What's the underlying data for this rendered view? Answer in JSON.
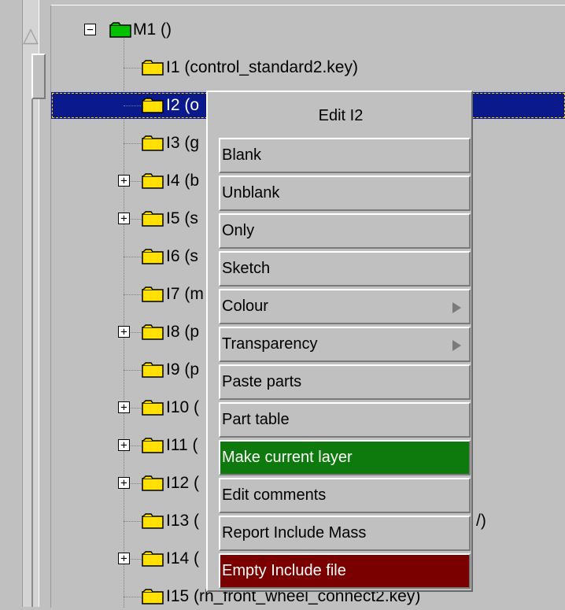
{
  "tree": {
    "root": {
      "label": "M1 ()",
      "expander": "⊟",
      "icon": "folder-green-icon"
    },
    "items": [
      {
        "label": "I1 (control_standard2.key)",
        "expander": ""
      },
      {
        "label": "I2 (o",
        "expander": "",
        "selected": true
      },
      {
        "label": "I3 (g",
        "expander": ""
      },
      {
        "label": "I4 (b",
        "expander": "+"
      },
      {
        "label": "I5 (s",
        "expander": "+"
      },
      {
        "label": "I6 (s",
        "expander": ""
      },
      {
        "label": "I7 (m",
        "expander": ""
      },
      {
        "label": "I8 (p",
        "expander": "+"
      },
      {
        "label": "I9 (p",
        "expander": ""
      },
      {
        "label": "I10 (",
        "expander": "+"
      },
      {
        "label": "I11 (",
        "expander": "+"
      },
      {
        "label": "I12 (",
        "expander": "+"
      },
      {
        "label": "I13 (",
        "expander": "",
        "tail": "/)"
      },
      {
        "label": "I14 (",
        "expander": "+"
      },
      {
        "label": "I15 (rh_front_wheel_connect2.key)",
        "expander": ""
      }
    ]
  },
  "context_menu": {
    "title": "Edit I2",
    "items": [
      {
        "label": "Blank"
      },
      {
        "label": "Unblank"
      },
      {
        "label": "Only"
      },
      {
        "label": "Sketch"
      },
      {
        "label": "Colour",
        "submenu": true
      },
      {
        "label": "Transparency",
        "submenu": true
      },
      {
        "label": "Paste parts"
      },
      {
        "label": "Part table"
      },
      {
        "label": "Make current layer",
        "color": "#0e7a0e"
      },
      {
        "label": "Edit comments"
      },
      {
        "label": "Report Include Mass"
      },
      {
        "label": "Empty Include file",
        "color": "#7a0000"
      }
    ]
  },
  "colors": {
    "selection": "#0a1a8c",
    "folder_yellow": "#ffe000",
    "folder_green": "#00c000"
  }
}
